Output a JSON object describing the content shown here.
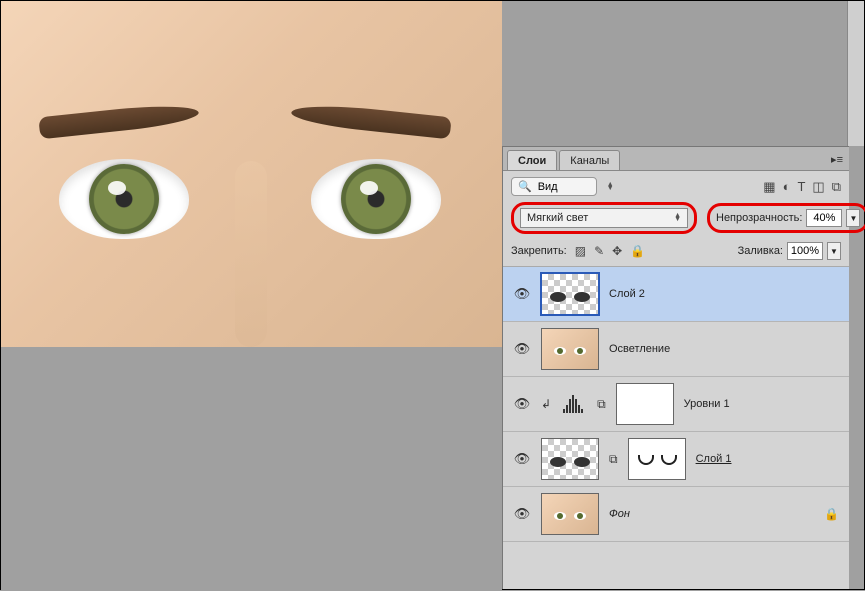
{
  "tabs": {
    "layers": "Слои",
    "channels": "Каналы"
  },
  "filter": {
    "search_placeholder": "Вид"
  },
  "blend": {
    "mode": "Мягкий свет"
  },
  "opacity": {
    "label": "Непрозрачность:",
    "value": "40%"
  },
  "lock": {
    "label": "Закрепить:"
  },
  "fill": {
    "label": "Заливка:",
    "value": "100%"
  },
  "layers": [
    {
      "name": "Слой 2"
    },
    {
      "name": "Осветление"
    },
    {
      "name": "Уровни 1"
    },
    {
      "name": "Слой 1"
    },
    {
      "name": "Фон"
    }
  ]
}
